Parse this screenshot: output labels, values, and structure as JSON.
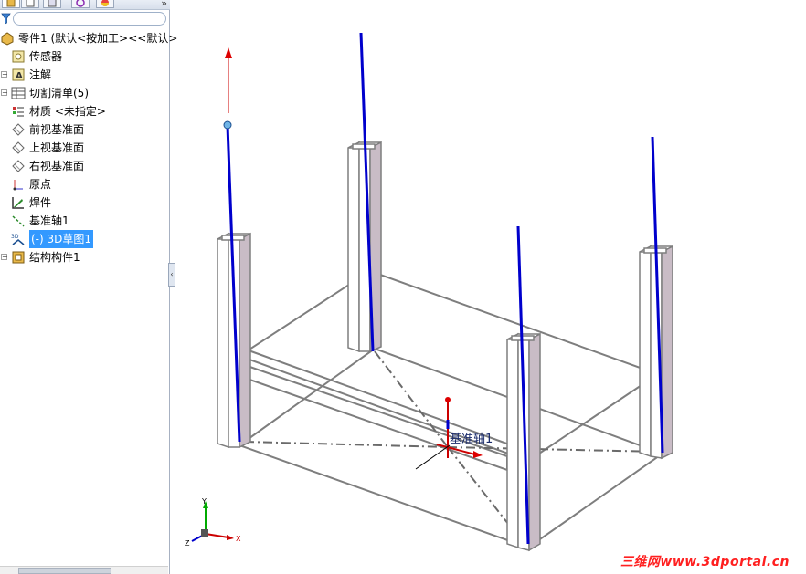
{
  "panel": {
    "tabs": [
      {
        "icon": "feature-manager-icon",
        "active": true
      },
      {
        "icon": "property-manager-icon",
        "active": false
      },
      {
        "icon": "configuration-manager-icon",
        "active": false
      },
      {
        "icon": "dimxpert-icon",
        "active": false
      },
      {
        "icon": "display-manager-icon",
        "active": false
      }
    ],
    "expand_chevron": "»",
    "filter_icon": "filter-icon"
  },
  "tree": {
    "items": [
      {
        "label": "零件1 (默认<按加工><<默认>",
        "icon": "part-icon",
        "twisty": "",
        "selected": false
      },
      {
        "label": "传感器",
        "icon": "sensor-icon",
        "twisty": "",
        "selected": false
      },
      {
        "label": "注解",
        "icon": "annotation-icon",
        "twisty": "+",
        "selected": false
      },
      {
        "label": "切割清单(5)",
        "icon": "cut-list-icon",
        "twisty": "+",
        "selected": false
      },
      {
        "label": "材质 <未指定>",
        "icon": "material-icon",
        "twisty": "",
        "selected": false
      },
      {
        "label": "前视基准面",
        "icon": "plane-icon",
        "twisty": "",
        "selected": false
      },
      {
        "label": "上视基准面",
        "icon": "plane-icon",
        "twisty": "",
        "selected": false
      },
      {
        "label": "右视基准面",
        "icon": "plane-icon",
        "twisty": "",
        "selected": false
      },
      {
        "label": "原点",
        "icon": "origin-icon",
        "twisty": "",
        "selected": false
      },
      {
        "label": "焊件",
        "icon": "weldment-icon",
        "twisty": "",
        "selected": false
      },
      {
        "label": "基准轴1",
        "icon": "axis-icon",
        "twisty": "",
        "selected": false
      },
      {
        "label": "(-) 3D草图1",
        "icon": "sketch-3d-icon",
        "twisty": "",
        "selected": true
      },
      {
        "label": "结构构件1",
        "icon": "structural-member-icon",
        "twisty": "+",
        "selected": false
      }
    ]
  },
  "viewport": {
    "axis_callout": "基准轴1",
    "triad_labels": {
      "x": "X",
      "y": "Y",
      "z": "Z"
    },
    "watermark": "三维网www.3dportal.cn"
  },
  "colors": {
    "selection": "#3399ff",
    "sketch_line": "#0000cc",
    "frame_edge": "#808080",
    "tube_face": "#c9bcc6",
    "watermark": "#ff2020"
  }
}
